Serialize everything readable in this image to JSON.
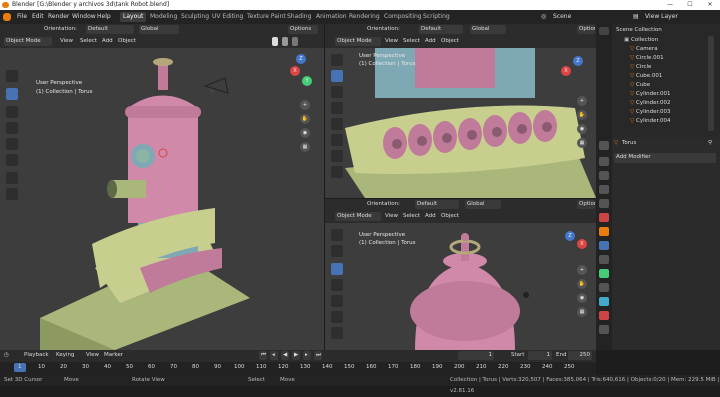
{
  "window": {
    "title": "Blender [G:\\Blender y archivos 3d\\tank Robot.blend]",
    "minimize": "—",
    "maximize": "☐",
    "close": "✕"
  },
  "menu": [
    "File",
    "Edit",
    "Render",
    "Window",
    "Help"
  ],
  "workspaces": [
    "Layout",
    "Modeling",
    "Sculpting",
    "UV Editing",
    "Texture Paint",
    "Shading",
    "Animation",
    "Rendering",
    "Compositing",
    "Scripting"
  ],
  "scene": {
    "label": "Scene",
    "view_layer": "View Layer"
  },
  "viewport_header": {
    "orientation_label": "Orientation:",
    "orientation": "Default",
    "transform": "Global",
    "options": "Options",
    "mode": "Object Mode",
    "view": "View",
    "select": "Select",
    "add": "Add",
    "object": "Object"
  },
  "viewports": [
    {
      "perspective": "User Perspective",
      "collection": "(1) Collection | Torus"
    },
    {
      "perspective": "User Perspective",
      "collection": "(1) Collection | Torus"
    },
    {
      "perspective": "User Perspective",
      "collection": "(1) Collection | Torus"
    }
  ],
  "outliner": {
    "title": "Scene Collection",
    "items": [
      "Collection",
      "Camera",
      "Circle.001",
      "Circle",
      "Cube.001",
      "Cube",
      "Cylinder.001",
      "Cylinder.002",
      "Cylinder.003",
      "Cylinder.004"
    ]
  },
  "properties": {
    "object": "Torus",
    "add_modifier": "Add Modifier"
  },
  "timeline": {
    "playback": "Playback",
    "keying": "Keying",
    "view": "View",
    "marker": "Marker",
    "current_frame": "1",
    "start_label": "Start",
    "start": "1",
    "end_label": "End",
    "end": "250",
    "ticks": [
      "1",
      "10",
      "20",
      "30",
      "40",
      "50",
      "60",
      "70",
      "80",
      "90",
      "100",
      "110",
      "120",
      "130",
      "140",
      "150",
      "160",
      "170",
      "180",
      "190",
      "200",
      "210",
      "220",
      "230",
      "240",
      "250"
    ]
  },
  "status": {
    "cursor": "Set 3D Cursor",
    "move": "Move",
    "rotate": "Rotate View",
    "select": "Select",
    "move2": "Move",
    "stats": "Collection | Torus | Verts:320,507 | Faces:385,064 | Tris:640,616 | Objects:0/20 | Mem: 229.5 MiB | v2.81.16"
  }
}
